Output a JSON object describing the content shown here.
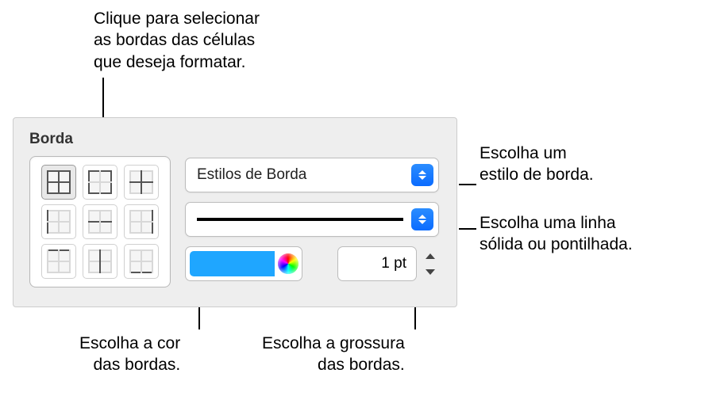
{
  "callouts": {
    "top": "Clique para selecionar\nas bordas das células\nque deseja formatar.",
    "style": "Escolha um\nestilo de borda.",
    "linetype": "Escolha uma linha\nsólida ou pontilhada.",
    "color": "Escolha a cor\ndas bordas.",
    "thickness": "Escolha a grossura\ndas bordas."
  },
  "panel": {
    "title": "Borda",
    "style_popup_label": "Estilos de Borda",
    "thickness_value": "1 pt",
    "color_swatch": "#1fa6ff"
  },
  "border_picker": {
    "items": [
      {
        "name": "all-borders",
        "bold": [
          "top",
          "bot",
          "lef",
          "rig",
          "midh",
          "midv"
        ],
        "selected": true
      },
      {
        "name": "outer-borders",
        "bold": [
          "top",
          "bot",
          "lef",
          "rig"
        ]
      },
      {
        "name": "inner-borders",
        "bold": [
          "midh",
          "midv"
        ]
      },
      {
        "name": "left-border",
        "bold": [
          "lef"
        ]
      },
      {
        "name": "horiz-mid-border",
        "bold": [
          "midh"
        ]
      },
      {
        "name": "right-border",
        "bold": [
          "rig"
        ]
      },
      {
        "name": "top-border",
        "bold": [
          "top"
        ]
      },
      {
        "name": "vert-mid-border",
        "bold": [
          "midv"
        ]
      },
      {
        "name": "bottom-border",
        "bold": [
          "bot"
        ]
      }
    ]
  }
}
